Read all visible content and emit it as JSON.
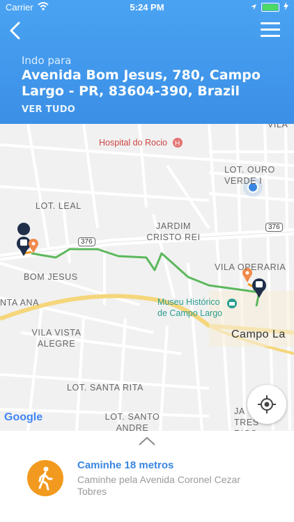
{
  "status_bar": {
    "carrier": "Carrier",
    "time": "5:24 PM"
  },
  "header": {
    "going_to": "Indo para",
    "destination": "Avenida Bom Jesus, 780, Campo Largo - PR, 83604-390, Brazil",
    "see_all": "VER TUDO"
  },
  "map": {
    "labels": {
      "hospital": "Hospital do Rocio",
      "vila": "VILA",
      "lot_ouro_verde": "LOT. OURO VERDE I",
      "lot_leal": "LOT. LEAL",
      "jardim_cristo_rei": "JARDIM CRISTO REI",
      "bom_jesus": "BOM JESUS",
      "vila_operaria": "VILA OPERARIA",
      "santa_ana": "NTA ANA",
      "museu": "Museu Histórico de Campo Largo",
      "vila_vista_alegre": "VILA VISTA ALEGRE",
      "campo_largo": "Campo La",
      "lot_santa_rita": "LOT. SANTA RITA",
      "lot_santo_andre": "LOT. SANTO ANDRE",
      "ja_tres_rios": "JA TRES RIOS",
      "route_shield_1": "376",
      "route_shield_2": "376",
      "google": "Google"
    }
  },
  "step": {
    "title": "Caminhe 18 metros",
    "subtitle": "Caminhe pela Avenida Coronel Cezar Tobres"
  },
  "colors": {
    "header": "#4aa3f2",
    "route": "#5cb85c",
    "walk_badge": "#f29a1f",
    "link": "#3a86e0"
  },
  "icons": [
    "wifi-icon",
    "location-arrow-icon",
    "battery-icon",
    "back-arrow-icon",
    "menu-icon",
    "hospital-icon",
    "bus-stop-icon",
    "place-pin-icon",
    "museum-icon",
    "current-location-icon",
    "locate-icon",
    "chevron-up-icon",
    "walking-icon"
  ]
}
